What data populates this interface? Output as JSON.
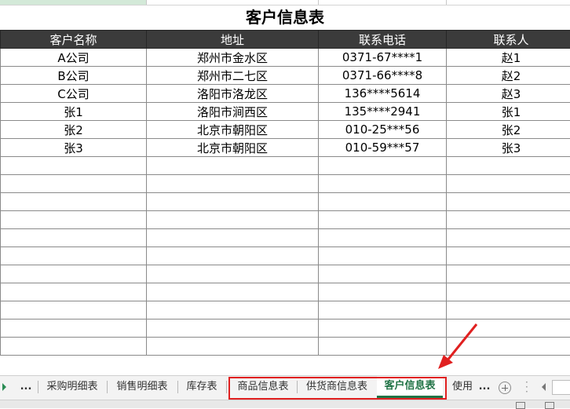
{
  "sheet": {
    "title": "客户信息表",
    "headers": [
      "客户名称",
      "地址",
      "联系电话",
      "联系人"
    ],
    "rows": [
      [
        "A公司",
        "郑州市金水区",
        "0371-67****1",
        "赵1"
      ],
      [
        "B公司",
        "郑州市二七区",
        "0371-66****8",
        "赵2"
      ],
      [
        "C公司",
        "洛阳市洛龙区",
        "136****5614",
        "赵3"
      ],
      [
        "张1",
        "洛阳市涧西区",
        "135****2941",
        "张1"
      ],
      [
        "张2",
        "北京市朝阳区",
        "010-25***56",
        "张2"
      ],
      [
        "张3",
        "北京市朝阳区",
        "010-59***57",
        "张3"
      ],
      [
        "",
        "",
        "",
        ""
      ],
      [
        "",
        "",
        "",
        ""
      ],
      [
        "",
        "",
        "",
        ""
      ],
      [
        "",
        "",
        "",
        ""
      ],
      [
        "",
        "",
        "",
        ""
      ],
      [
        "",
        "",
        "",
        ""
      ],
      [
        "",
        "",
        "",
        ""
      ],
      [
        "",
        "",
        "",
        ""
      ],
      [
        "",
        "",
        "",
        ""
      ],
      [
        "",
        "",
        "",
        ""
      ],
      [
        "",
        "",
        "",
        ""
      ]
    ]
  },
  "tabs": {
    "more_left": "...",
    "items": [
      "采购明细表",
      "销售明细表",
      "库存表",
      "商品信息表",
      "供货商信息表",
      "客户信息表",
      "使用"
    ],
    "active": "客户信息表",
    "more_right": "..."
  },
  "colors": {
    "header_bg": "#3b3b3b",
    "active_tab": "#217346",
    "annotation": "#e02020"
  },
  "icons": [
    "nav-right-icon",
    "add-sheet-icon",
    "scroll-left-icon",
    "normal-view-icon",
    "page-layout-icon"
  ]
}
